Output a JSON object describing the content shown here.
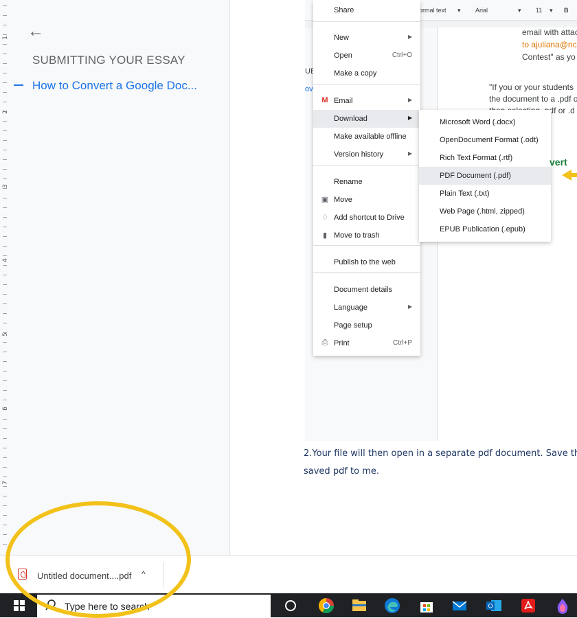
{
  "ruler": {
    "numbers": [
      "1",
      "2",
      "3",
      "4",
      "5",
      "6",
      "7"
    ]
  },
  "outline": {
    "back_icon": "arrow-left-icon",
    "heading": "SUBMITTING YOUR ESSAY",
    "subheading": "How to Convert a Google Doc..."
  },
  "screenshot": {
    "toolbar": {
      "style": "ormal text",
      "font": "Arial",
      "size": "11",
      "bold": "B"
    },
    "left_fragments": [
      "UE",
      "ov"
    ],
    "page_lines": [
      "email with attac",
      "to ajuliana@nc",
      "Contest\" as yo",
      "\"If you or your students",
      "the document to a .pdf o",
      "then selecting .pdf or .d"
    ],
    "convert_tag": "vert"
  },
  "file_menu": {
    "items": [
      {
        "label": "Share",
        "shortcut": "",
        "arrow": false,
        "icon": ""
      },
      {
        "label": "New",
        "shortcut": "",
        "arrow": true,
        "icon": ""
      },
      {
        "label": "Open",
        "shortcut": "Ctrl+O",
        "arrow": false,
        "icon": ""
      },
      {
        "label": "Make a copy",
        "shortcut": "",
        "arrow": false,
        "icon": ""
      },
      {
        "label": "Email",
        "shortcut": "",
        "arrow": true,
        "icon": "gmail-icon"
      },
      {
        "label": "Download",
        "shortcut": "",
        "arrow": true,
        "icon": "",
        "highlighted": true
      },
      {
        "label": "Make available offline",
        "shortcut": "",
        "arrow": false,
        "icon": ""
      },
      {
        "label": "Version history",
        "shortcut": "",
        "arrow": true,
        "icon": ""
      },
      {
        "label": "Rename",
        "shortcut": "",
        "arrow": false,
        "icon": ""
      },
      {
        "label": "Move",
        "shortcut": "",
        "arrow": false,
        "icon": "move-folder-icon"
      },
      {
        "label": "Add shortcut to Drive",
        "shortcut": "",
        "arrow": false,
        "icon": "drive-shortcut-icon"
      },
      {
        "label": "Move to trash",
        "shortcut": "",
        "arrow": false,
        "icon": "trash-icon"
      },
      {
        "label": "Publish to the web",
        "shortcut": "",
        "arrow": false,
        "icon": ""
      },
      {
        "label": "Document details",
        "shortcut": "",
        "arrow": false,
        "icon": ""
      },
      {
        "label": "Language",
        "shortcut": "",
        "arrow": true,
        "icon": ""
      },
      {
        "label": "Page setup",
        "shortcut": "",
        "arrow": false,
        "icon": ""
      },
      {
        "label": "Print",
        "shortcut": "Ctrl+P",
        "arrow": false,
        "icon": "printer-icon"
      }
    ]
  },
  "download_submenu": {
    "items": [
      {
        "label": "Microsoft Word (.docx)"
      },
      {
        "label": "OpenDocument Format (.odt)"
      },
      {
        "label": "Rich Text Format (.rtf)"
      },
      {
        "label": "PDF Document (.pdf)",
        "highlighted": true
      },
      {
        "label": "Plain Text (.txt)"
      },
      {
        "label": "Web Page (.html, zipped)"
      },
      {
        "label": "EPUB Publication (.epub)"
      }
    ]
  },
  "paragraph": {
    "line1": "2.Your file will then open in a separate pdf document. Save th",
    "line2": "saved pdf to me."
  },
  "download_bar": {
    "file_name": "Untitled document....pdf",
    "caret": "^"
  },
  "taskbar": {
    "search_placeholder": "Type here to search",
    "apps": [
      "task-view-icon",
      "chrome-icon",
      "file-explorer-icon",
      "edge-icon",
      "store-icon",
      "mail-icon",
      "outlook-icon",
      "acrobat-icon",
      "paint-drop-icon"
    ]
  },
  "colors": {
    "accent": "#1a73e8",
    "highlight_ellipse": "#f2c21b",
    "convert_green": "#188038",
    "paragraph_text": "#1f3864"
  }
}
